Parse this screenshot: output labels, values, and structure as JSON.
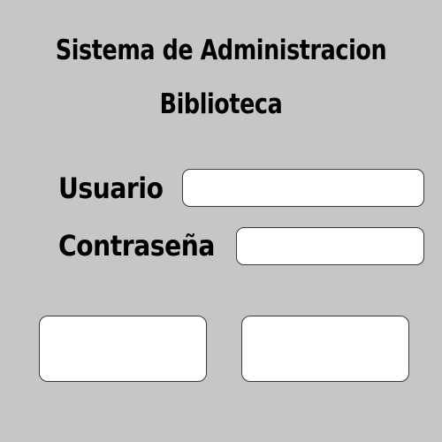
{
  "header": {
    "title_line1": "Sistema de Administracion",
    "title_line2": "Biblioteca"
  },
  "login_form": {
    "username_label": "Usuario",
    "username_value": "",
    "password_label": "Contraseña",
    "password_value": ""
  },
  "actions": {
    "left_button_label": "",
    "right_button_label": ""
  },
  "colors": {
    "background": "#c6c6c6",
    "field_background": "#ffffff",
    "border": "#3a3a3a",
    "text": "#000000"
  }
}
